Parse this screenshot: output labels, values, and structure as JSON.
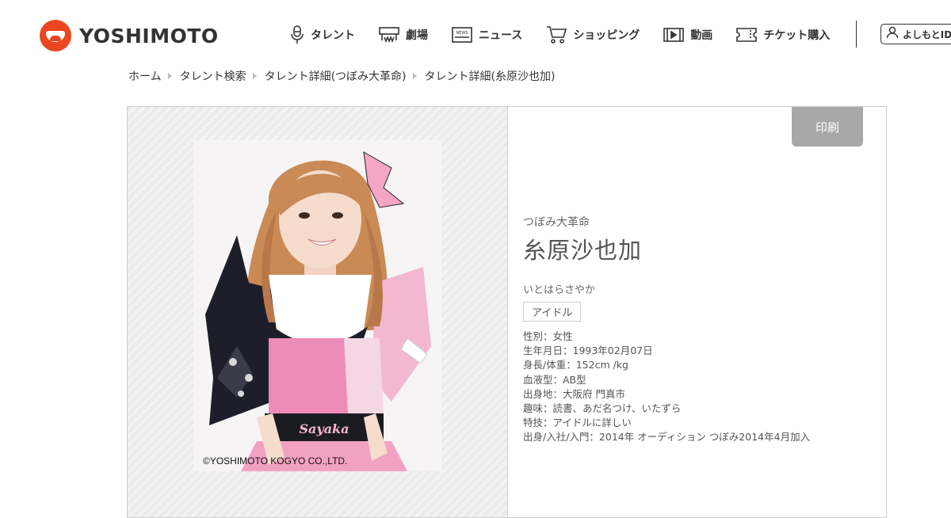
{
  "brand": {
    "name": "YOSHIMOTO"
  },
  "nav": {
    "items": [
      {
        "label": "タレント",
        "icon": "microphone-icon"
      },
      {
        "label": "劇場",
        "icon": "theater-icon"
      },
      {
        "label": "ニュース",
        "icon": "news-icon"
      },
      {
        "label": "ショッピング",
        "icon": "cart-icon"
      },
      {
        "label": "動画",
        "icon": "video-icon"
      },
      {
        "label": "チケット購入",
        "icon": "ticket-icon"
      }
    ],
    "news_icon_text": "NEWS",
    "account": {
      "label": "よしもとID",
      "icon": "user-icon"
    }
  },
  "breadcrumb": [
    "ホーム",
    "タレント検索",
    "タレント詳細(つぼみ大革命)",
    "タレント詳細(糸原沙也加)"
  ],
  "profile": {
    "print_label": "印刷",
    "group": "つぼみ大革命",
    "name": "糸原沙也加",
    "kana": "いとはらさやか",
    "tag": "アイドル",
    "details": [
      "性別：女性",
      "生年月日：1993年02月07日",
      "身長/体重：152cm /kg",
      "血液型：AB型",
      "出身地：大阪府 門真市",
      "趣味：読書、あだ名つけ、いたずら",
      "特技：アイドルに詳しい",
      "出身/入社/入門：2014年 オーディション つぼみ2014年4月加入"
    ],
    "photo_copyright": "©YOSHIMOTO KOGYO CO.,LTD.",
    "photo_waist_text": "Sayaka"
  },
  "colors": {
    "brand": "#e8461f",
    "print_button": "#a8a8a8"
  }
}
